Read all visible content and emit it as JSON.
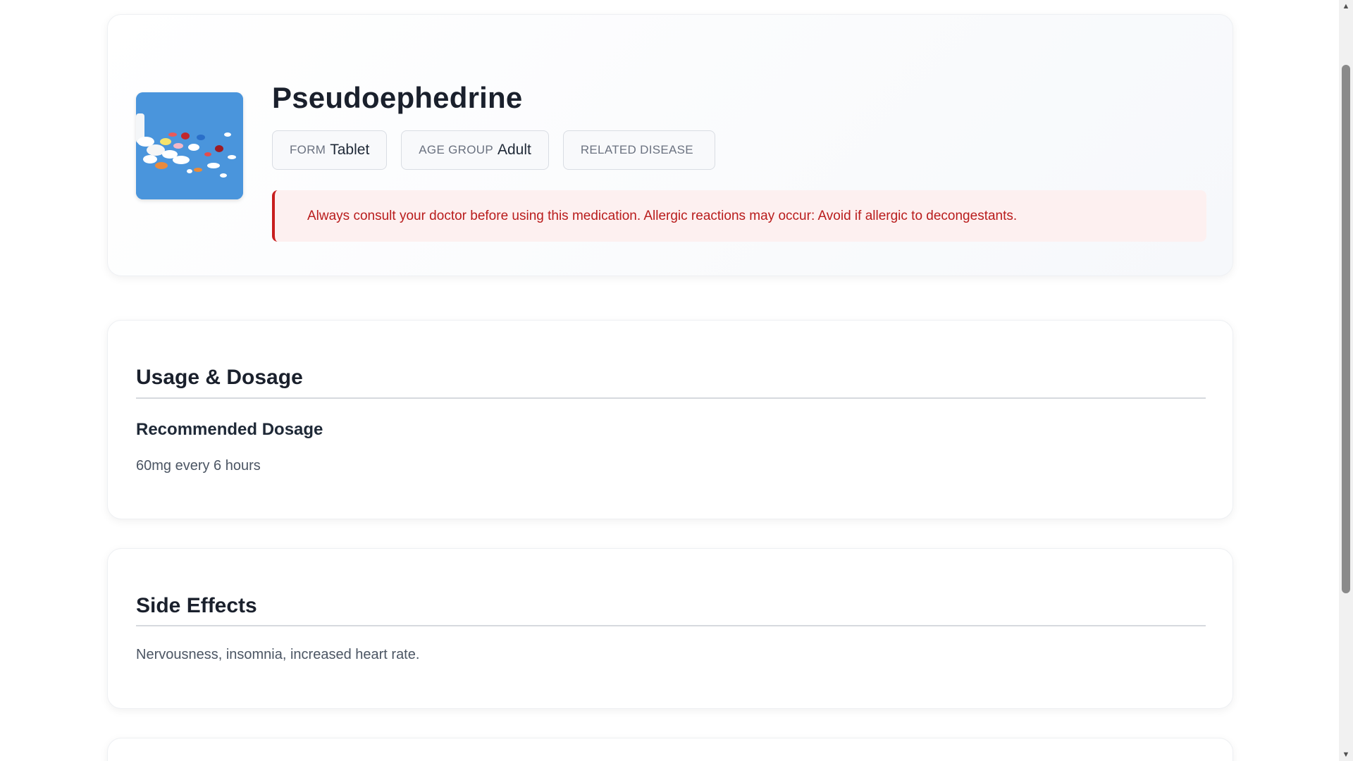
{
  "medication": {
    "name": "Pseudoephedrine",
    "image_icon": "pills-photo-icon",
    "chips": [
      {
        "label": "FORM",
        "value": "Tablet"
      },
      {
        "label": "AGE GROUP",
        "value": "Adult"
      },
      {
        "label": "RELATED DISEASE",
        "value": ""
      }
    ],
    "warning": "Always consult your doctor before using this medication. Allergic reactions may occur: Avoid if allergic to decongestants."
  },
  "usage": {
    "title": "Usage & Dosage",
    "subtitle": "Recommended Dosage",
    "text": "60mg every 6 hours"
  },
  "side_effects": {
    "title": "Side Effects",
    "text": "Nervousness, insomnia, increased heart rate."
  },
  "colors": {
    "warning_text": "#b91c1c",
    "warning_border": "#c81e1e",
    "warning_bg": "#fdf0f0"
  }
}
